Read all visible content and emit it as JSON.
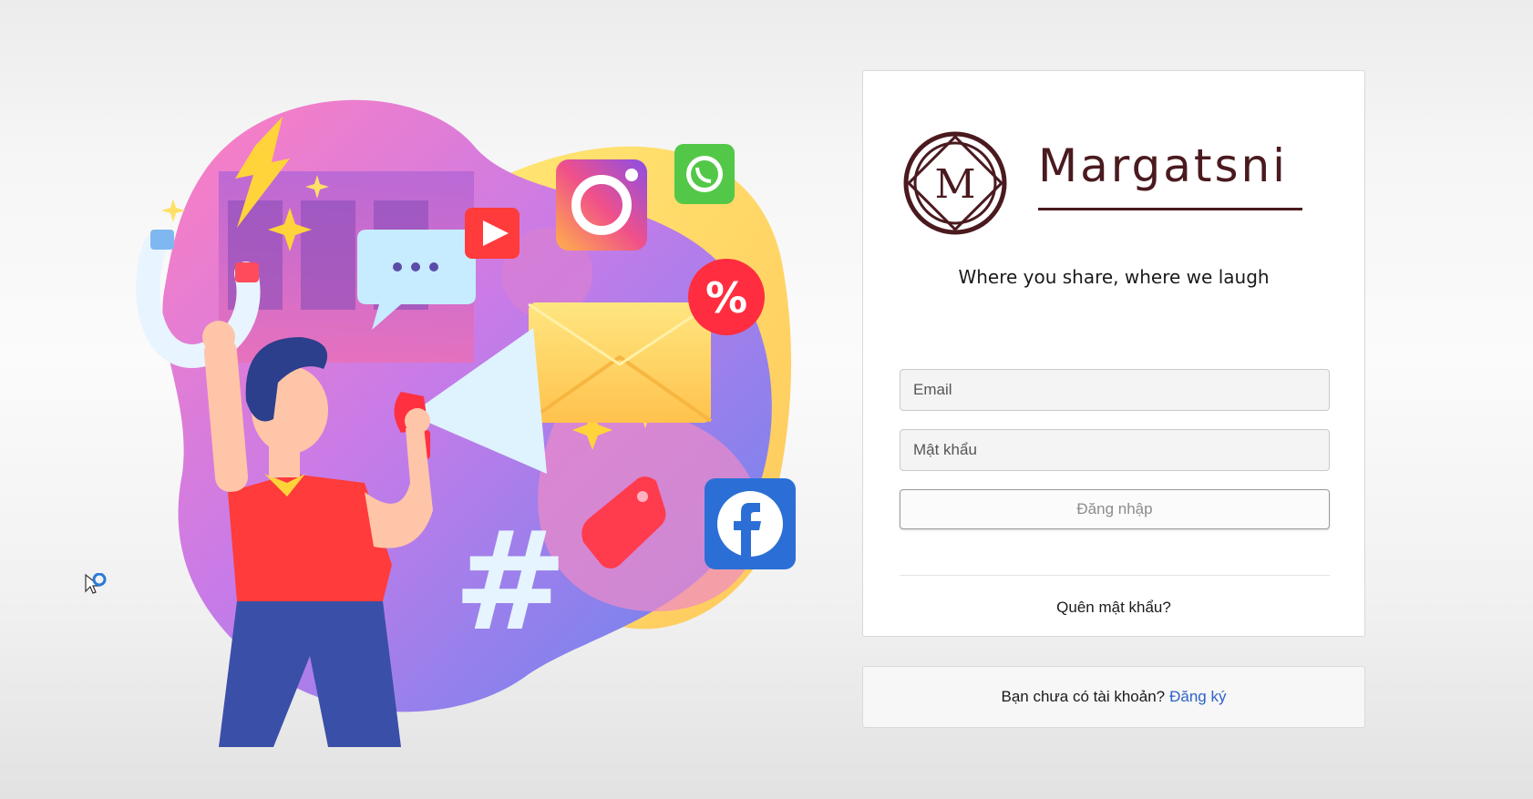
{
  "brand": {
    "name": "Margatsni",
    "logo_letter": "M",
    "tagline": "Where you share, where we laugh",
    "color": "#4a1a1f"
  },
  "illustration": {
    "hashtag": "#",
    "percent": "%"
  },
  "login": {
    "email_placeholder": "Email",
    "password_placeholder": "Mật khẩu",
    "submit_label": "Đăng nhập",
    "forgot_label": "Quên mật khẩu?"
  },
  "signup": {
    "prompt": "Bạn chưa có tài khoản?",
    "link_label": "Đăng ký",
    "link_color": "#2f62c8"
  },
  "icons": [
    "instagram-icon",
    "whatsapp-icon",
    "youtube-play-icon",
    "facebook-icon",
    "chat-bubble-icon",
    "envelope-icon",
    "megaphone-icon",
    "magnet-icon",
    "lightning-icon",
    "price-tag-icon",
    "cursor-icon"
  ]
}
